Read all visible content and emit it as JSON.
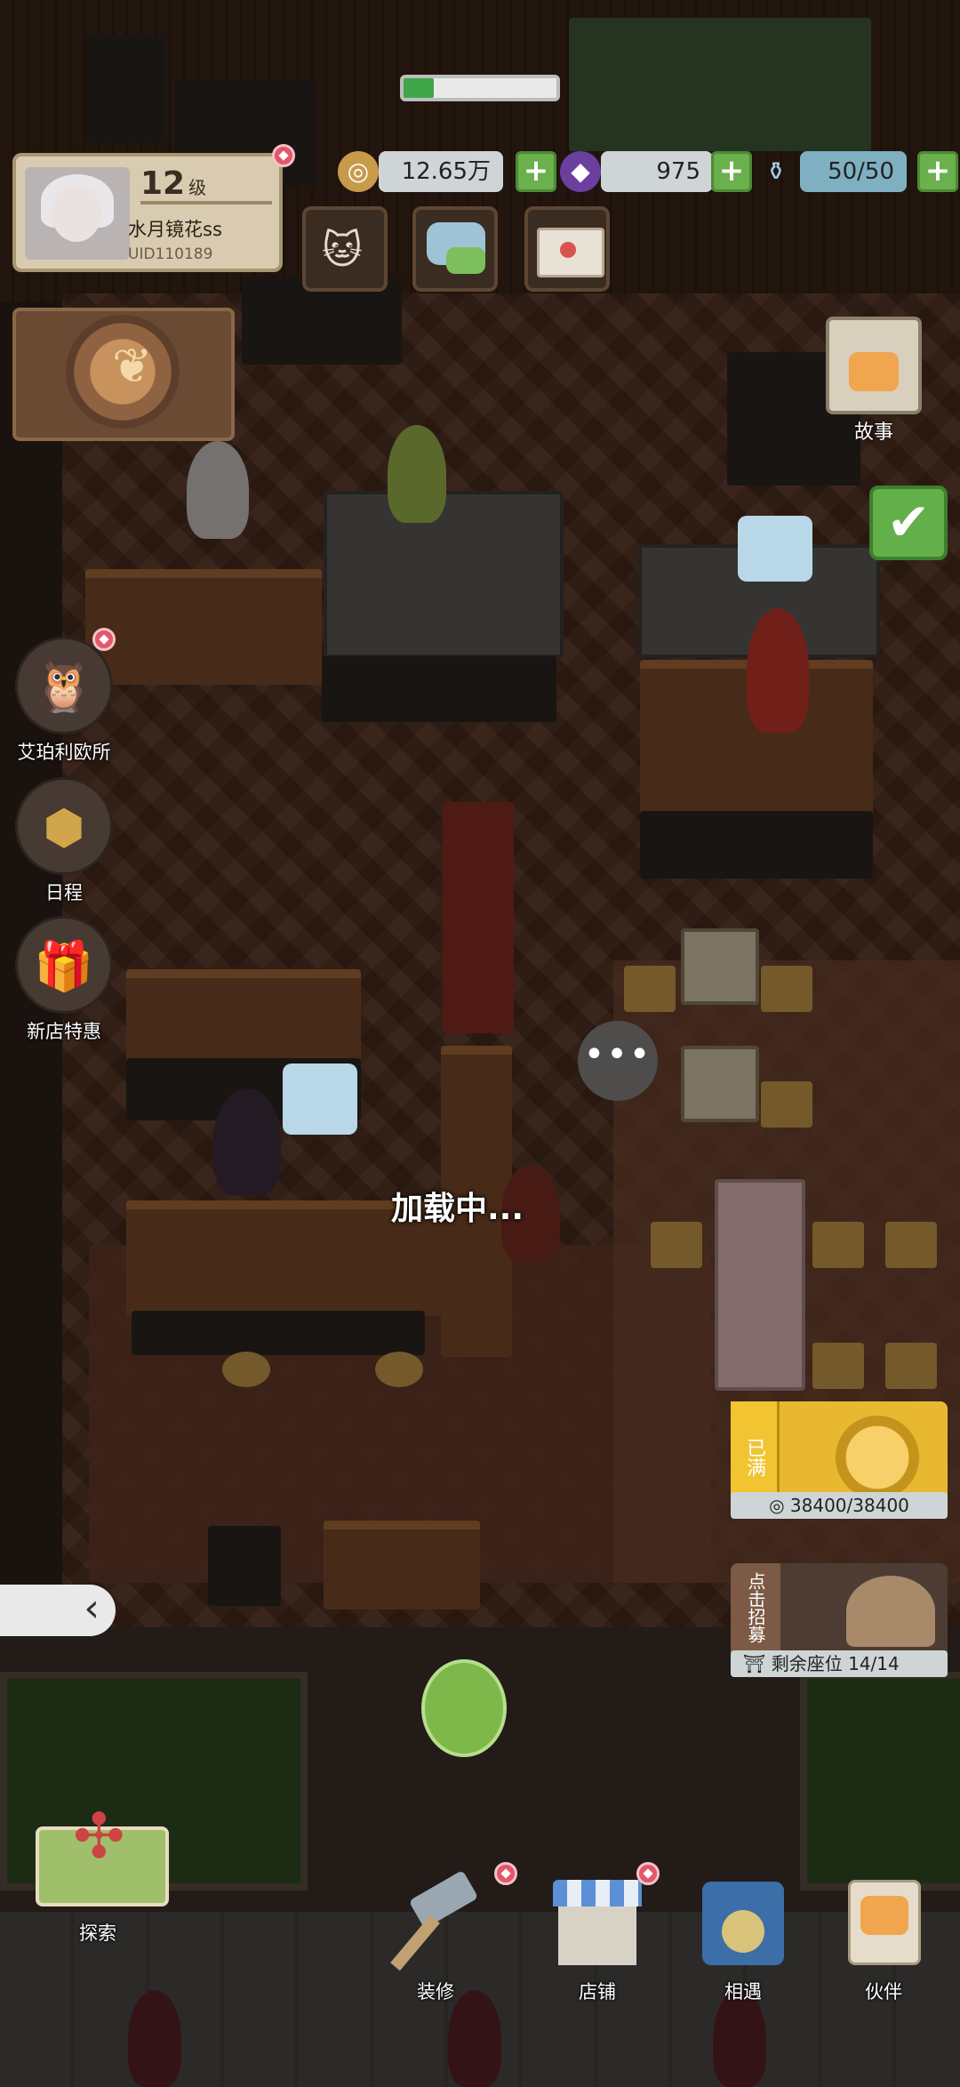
{
  "profile": {
    "level": "12",
    "level_unit": "级",
    "name": "水月镜花ss",
    "uid": "UID110189"
  },
  "currency": {
    "coins": "12.65万",
    "gems": "975",
    "energy": "50/50"
  },
  "top_progress": {
    "fill_fraction": 0.2
  },
  "side_menu": {
    "agency": "艾珀利欧所",
    "schedule": "日程",
    "new_store_deal": "新店特惠"
  },
  "story": {
    "label": "故事"
  },
  "loading_text": "加载中...",
  "bubble_text": "•••",
  "income": {
    "tag": "已满",
    "amount": "38400/38400"
  },
  "recruit": {
    "tag": "点击招募",
    "seats": "剩余座位 14/14"
  },
  "bottom_nav": {
    "explore": "探索",
    "decorate": "装修",
    "store": "店铺",
    "encounter": "相遇",
    "partner": "伙伴"
  },
  "colors": {
    "accent_green": "#6ab04c",
    "gold": "#e8b930",
    "badge_red": "#e2576a"
  }
}
